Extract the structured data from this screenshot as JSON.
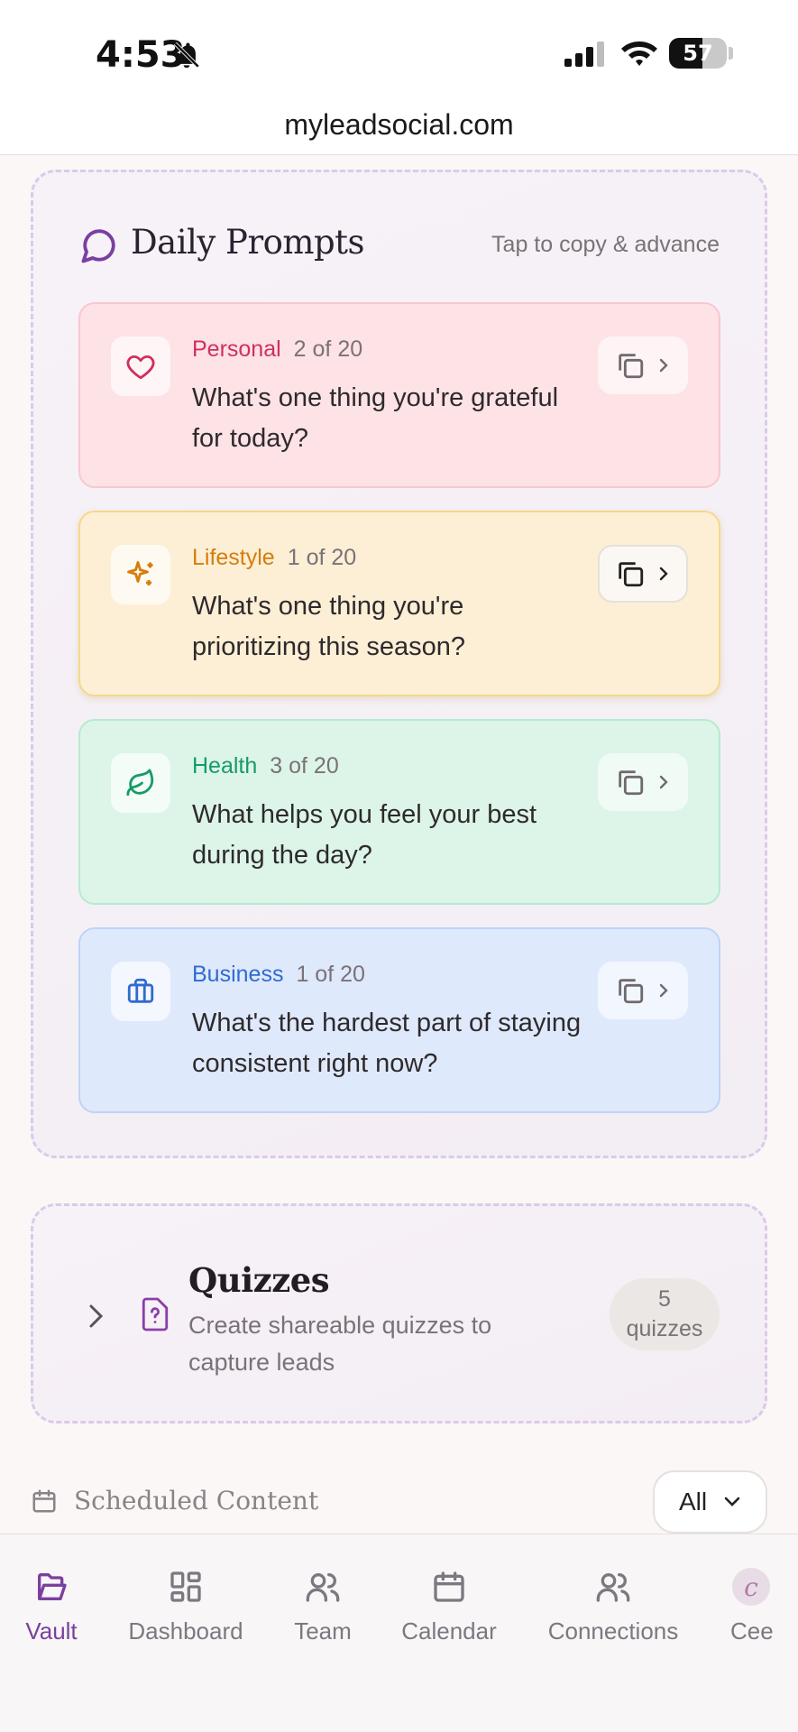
{
  "status_bar": {
    "time": "4:53",
    "battery": "57"
  },
  "browser": {
    "url": "myleadsocial.com"
  },
  "daily_prompts": {
    "title": "Daily Prompts",
    "hint": "Tap to copy & advance",
    "cards": [
      {
        "category": "Personal",
        "count": "2 of 20",
        "text": "What's one thing you're grateful for today?",
        "color": "#d12f5c",
        "icon": "heart-icon"
      },
      {
        "category": "Lifestyle",
        "count": "1 of 20",
        "text": "What's one thing you're prioritizing this season?",
        "color": "#d67d0c",
        "icon": "sparkles-icon"
      },
      {
        "category": "Health",
        "count": "3 of 20",
        "text": "What helps you feel your best during the day?",
        "color": "#179b67",
        "icon": "leaf-icon"
      },
      {
        "category": "Business",
        "count": "1 of 20",
        "text": "What's the hardest part of staying consistent right now?",
        "color": "#2f6bd1",
        "icon": "briefcase-icon"
      }
    ]
  },
  "quizzes": {
    "title": "Quizzes",
    "description": "Create shareable quizzes to capture leads",
    "badge_count": "5",
    "badge_label": "quizzes"
  },
  "scheduled": {
    "title": "Scheduled Content",
    "filter_value": "All"
  },
  "nav": [
    {
      "label": "Vault",
      "icon": "folder-open-icon",
      "active": true
    },
    {
      "label": "Dashboard",
      "icon": "grid-icon",
      "active": false
    },
    {
      "label": "Team",
      "icon": "users-icon",
      "active": false
    },
    {
      "label": "Calendar",
      "icon": "calendar-icon",
      "active": false
    },
    {
      "label": "Connections",
      "icon": "users-icon",
      "active": false
    },
    {
      "label": "Cee",
      "icon": "avatar",
      "active": false
    }
  ],
  "colors": {
    "accent": "#7b3fa0",
    "muted": "#7a7276"
  }
}
